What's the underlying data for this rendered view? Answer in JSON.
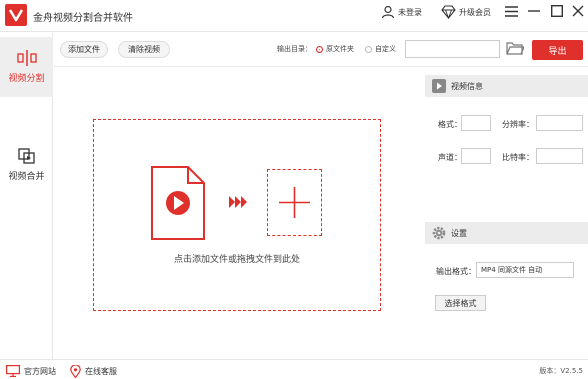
{
  "titlebar": {
    "app_title": "金舟视频分割合并软件",
    "login_label": "未登录",
    "vip_label": "升级会员"
  },
  "sidebar": {
    "items": [
      {
        "label": "视频分割",
        "active": true
      },
      {
        "label": "视频合并",
        "active": false
      }
    ]
  },
  "toolbar": {
    "add_file": "添加文件",
    "clear_video": "清除视频",
    "output_dir_label": "输出目录：",
    "option_source": "原文件夹",
    "option_custom": "自定义",
    "path_value": "",
    "export_label": "导出"
  },
  "dropzone": {
    "hint": "点击添加文件或拖拽文件到此处"
  },
  "video_info": {
    "title": "视频信息",
    "format_label": "格式：",
    "resolution_label": "分辨率：",
    "channel_label": "声道：",
    "bitrate_label": "比特率："
  },
  "settings": {
    "title": "设置",
    "output_format_label": "输出格式：",
    "output_format_value": "MP4 同源文件 自动",
    "choose_format": "选择格式"
  },
  "footer": {
    "website": "官方网站",
    "support": "在线客服",
    "version": "版本：V2.5.5"
  },
  "colors": {
    "accent": "#e0302b",
    "panel_bg": "#ececec"
  }
}
